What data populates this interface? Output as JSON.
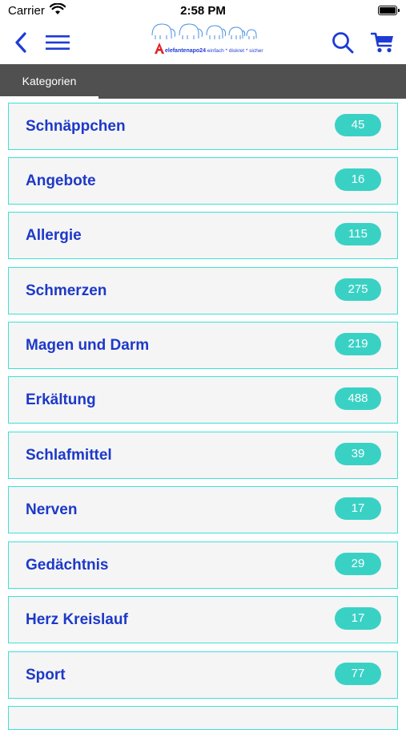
{
  "status_bar": {
    "carrier": "Carrier",
    "time": "2:58 PM"
  },
  "header": {
    "logo_name": "elefantenapo24",
    "logo_tagline": "einfach * diskret * sicher",
    "icons": [
      "back-chevron-icon",
      "hamburger-menu-icon",
      "search-icon",
      "cart-icon"
    ]
  },
  "tabs": [
    {
      "label": "Kategorien",
      "selected": true
    }
  ],
  "categories": [
    {
      "name": "Schnäppchen",
      "count": "45"
    },
    {
      "name": "Angebote",
      "count": "16"
    },
    {
      "name": "Allergie",
      "count": "115"
    },
    {
      "name": "Schmerzen",
      "count": "275"
    },
    {
      "name": "Magen und Darm",
      "count": "219"
    },
    {
      "name": "Erkältung",
      "count": "488"
    },
    {
      "name": "Schlafmittel",
      "count": "39"
    },
    {
      "name": "Nerven",
      "count": "17"
    },
    {
      "name": "Gedächtnis",
      "count": "29"
    },
    {
      "name": "Herz Kreislauf",
      "count": "17"
    },
    {
      "name": "Sport",
      "count": "77"
    }
  ],
  "colors": {
    "accent_blue": "#1d39c8",
    "teal_border": "#3be3d4",
    "badge_teal": "#3ad1c5",
    "tab_bar": "#505050",
    "logo_red": "#e02020"
  }
}
